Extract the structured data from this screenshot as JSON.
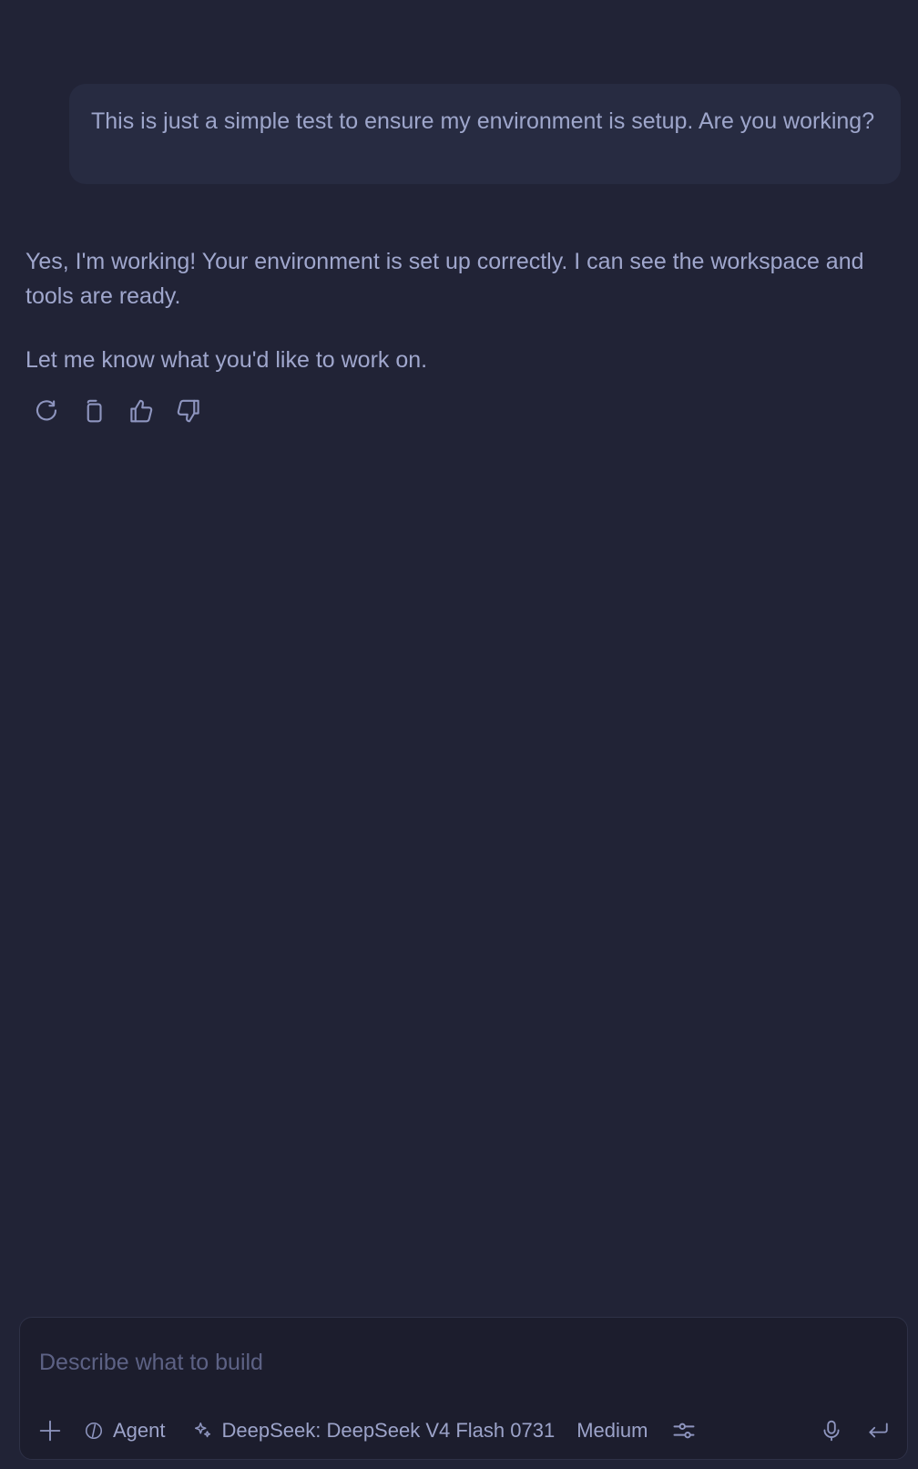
{
  "conversation": {
    "user_message": "This is just a simple test to ensure my environment is setup. Are you working?",
    "assistant_paragraphs": [
      "Yes, I'm working! Your environment is set up correctly. I can see the workspace and tools are ready.",
      "Let me know what you'd like to work on."
    ]
  },
  "actions": [
    {
      "name": "retry",
      "icon": "refresh-icon"
    },
    {
      "name": "copy",
      "icon": "copy-icon"
    },
    {
      "name": "thumbs-up",
      "icon": "thumbs-up-icon"
    },
    {
      "name": "thumbs-down",
      "icon": "thumbs-down-icon"
    }
  ],
  "composer": {
    "placeholder": "Describe what to build",
    "value": "",
    "mode_label": "Agent",
    "model_label": "DeepSeek: DeepSeek V4 Flash 0731",
    "effort_label": "Medium"
  },
  "colors": {
    "background": "#212336",
    "user_bubble": "#272b41",
    "composer_bg": "#1c1d2d",
    "text": "#a0a7cd",
    "icon": "#8e95bf",
    "placeholder": "#5d6285"
  }
}
